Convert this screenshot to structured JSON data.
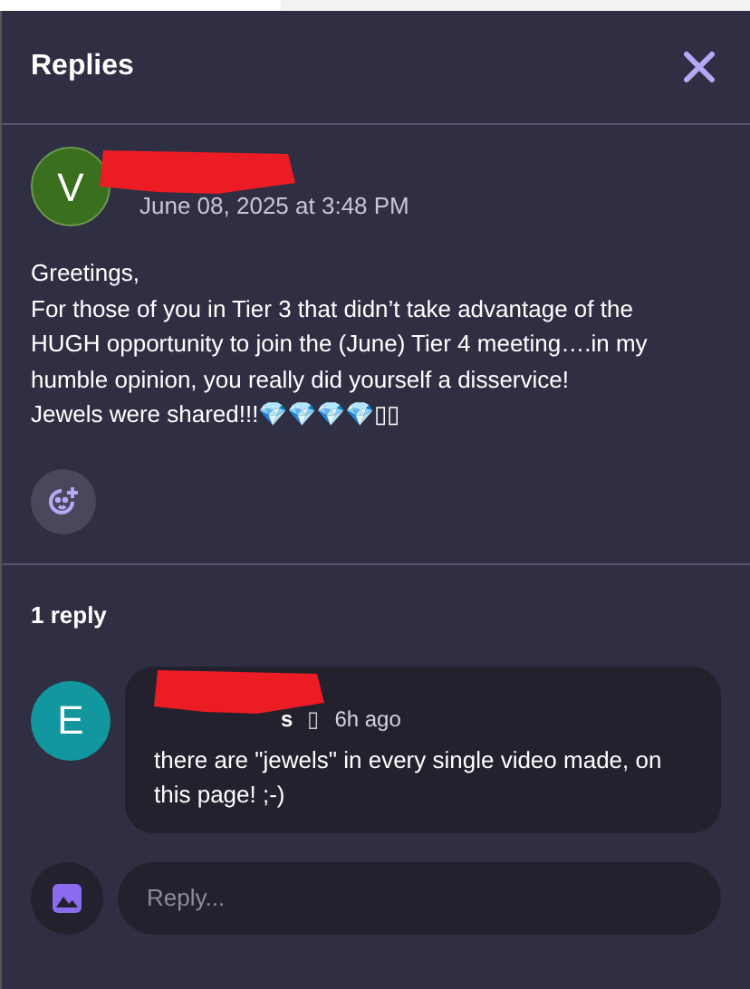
{
  "header": {
    "title": "Replies"
  },
  "post": {
    "avatar_letter": "V",
    "color": "#3a6f1e",
    "date": "June 08, 2025 at 3:48 PM",
    "lines": [
      "Greetings,",
      "For those of you in Tier 3 that didn’t take advantage of the HUGH opportunity to join the (June) Tier 4 meeting….in my humble opinion, you really did yourself a disservice!",
      "Jewels were shared!!!💎💎💎💎▯▯"
    ]
  },
  "reply_count": "1 reply",
  "replies": [
    {
      "avatar_letter": "E",
      "color": "#12979f",
      "author": "s",
      "separator": "▯",
      "time": "6h ago",
      "text": "there are \"jewels\" in every single video made, on this page! ;-)"
    }
  ],
  "composer": {
    "placeholder": "Reply..."
  }
}
